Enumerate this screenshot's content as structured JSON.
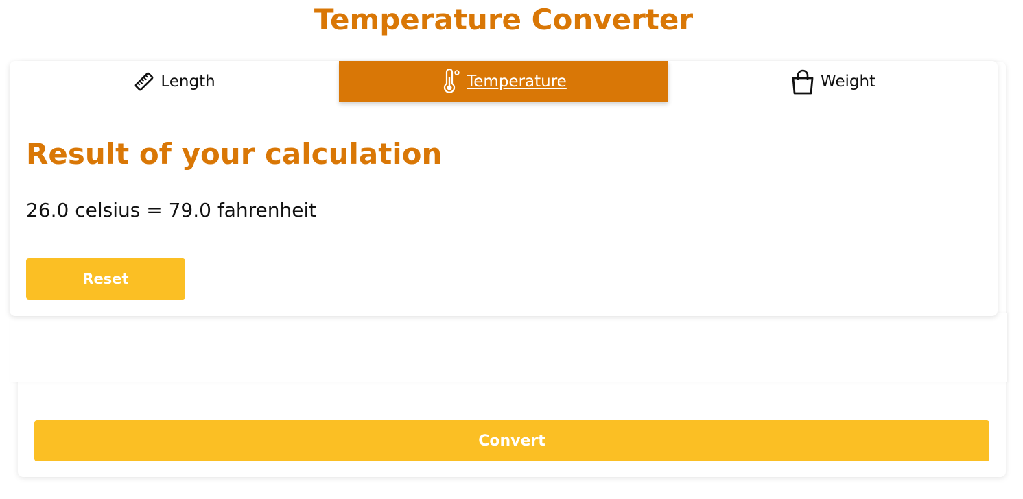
{
  "header": {
    "title": "Temperature Converter"
  },
  "tabs": [
    {
      "label": "Length",
      "icon": "ruler-icon",
      "active": false
    },
    {
      "label": "Temperature",
      "icon": "thermometer-icon",
      "active": true
    },
    {
      "label": "Weight",
      "icon": "shopping-bag-icon",
      "active": false
    }
  ],
  "result": {
    "heading": "Result of your calculation",
    "text": "26.0 celsius = 79.0 fahrenheit",
    "reset_label": "Reset"
  },
  "form": {
    "convert_label": "Convert"
  },
  "colors": {
    "accent": "#d97706",
    "button": "#fbbf24",
    "text": "#111111",
    "background": "#ffffff"
  }
}
